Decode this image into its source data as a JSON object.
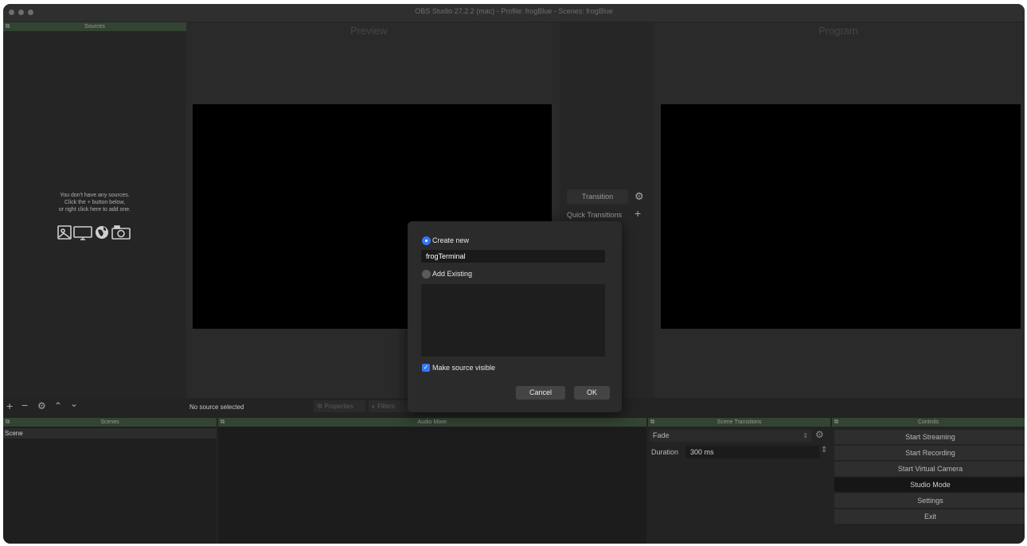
{
  "window": {
    "title": "OBS Studio 27.2.2 (mac) - Profile: frogBlue - Scenes: frogBlue"
  },
  "sources": {
    "header": "Sources",
    "empty_line1": "You don't have any sources.",
    "empty_line2": "Click the + button below,",
    "empty_line3": "or right click here to add one.",
    "icons": [
      "image-icon",
      "display-icon",
      "browser-icon",
      "camera-icon"
    ]
  },
  "preview": {
    "title": "Preview"
  },
  "program": {
    "title": "Program"
  },
  "transition_panel": {
    "transition_label": "Transition",
    "quick_label": "Quick Transitions"
  },
  "source_toolbar": {
    "status": "No source selected",
    "properties": "Properties",
    "filters": "Filters"
  },
  "scenes": {
    "header": "Scenes",
    "items": [
      "Scene"
    ]
  },
  "audio_mixer": {
    "header": "Audio Mixer"
  },
  "scene_transitions": {
    "header": "Scene Transitions",
    "selected": "Fade",
    "duration_label": "Duration",
    "duration_value": "300 ms"
  },
  "controls": {
    "header": "Controls",
    "buttons": [
      "Start Streaming",
      "Start Recording",
      "Start Virtual Camera",
      "Studio Mode",
      "Settings",
      "Exit"
    ]
  },
  "dialog": {
    "create_new_label": "Create new",
    "name_value": "frogTerminal",
    "add_existing_label": "Add Existing",
    "make_visible_label": "Make source visible",
    "make_visible_checked": true,
    "cancel_label": "Cancel",
    "ok_label": "OK"
  },
  "colors": {
    "accent": "#3478f6",
    "dock_header": "#334433",
    "background": "#232323"
  }
}
